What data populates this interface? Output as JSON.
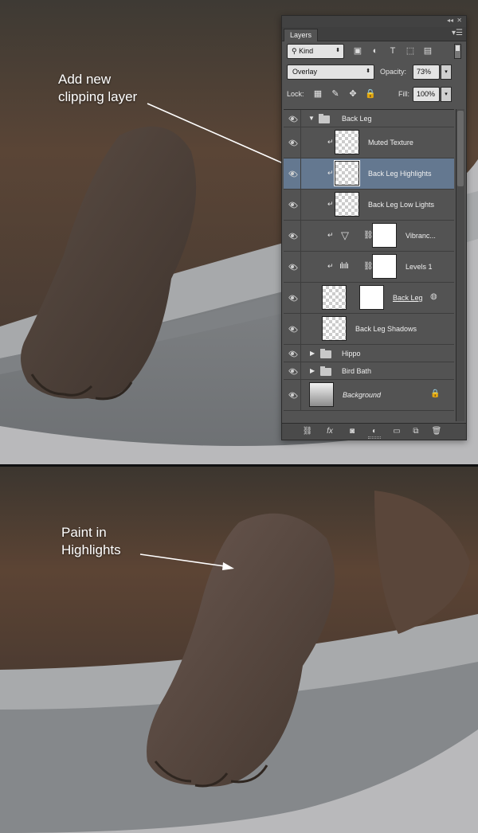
{
  "annotations": {
    "top": [
      "Add new",
      "clipping layer"
    ],
    "bottom": [
      "Paint in",
      "Highlights"
    ]
  },
  "panel": {
    "tab_label": "Layers",
    "filter": {
      "kind_label": "Kind"
    },
    "blend_mode": "Overlay",
    "opacity_label": "Opacity:",
    "opacity_value": "73%",
    "lock_label": "Lock:",
    "fill_label": "Fill:",
    "fill_value": "100%",
    "layers": [
      {
        "name": "Back Leg",
        "type": "group",
        "expanded": true
      },
      {
        "name": "Muted Texture",
        "type": "pixel",
        "clipped": true
      },
      {
        "name": "Back Leg Highlights",
        "type": "pixel",
        "clipped": true,
        "selected": true
      },
      {
        "name": "Back Leg Low Lights",
        "type": "pixel",
        "clipped": true
      },
      {
        "name": "Vibranc...",
        "type": "adjustment",
        "icon": "vibrance-icon",
        "clipped": true
      },
      {
        "name": "Levels 1",
        "type": "adjustment",
        "icon": "levels-icon",
        "clipped": true
      },
      {
        "name": "Back Leg",
        "type": "smart-with-mask"
      },
      {
        "name": "Back Leg Shadows",
        "type": "pixel"
      },
      {
        "name": "Hippo",
        "type": "group",
        "expanded": false
      },
      {
        "name": "Bird Bath",
        "type": "group",
        "expanded": false
      },
      {
        "name": "Background",
        "type": "background",
        "locked": true
      }
    ]
  },
  "colors": {
    "panel_bg": "#535353",
    "selected_row": "#647890",
    "canvas_bg": "#b9b9bb"
  }
}
